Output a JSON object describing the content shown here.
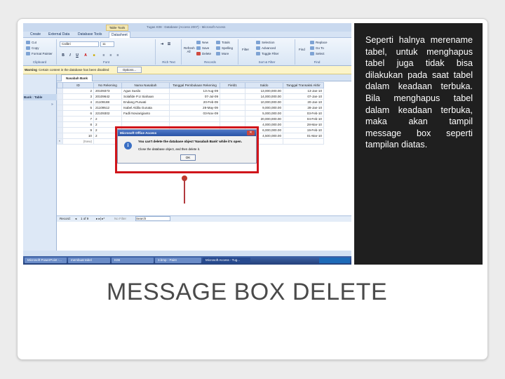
{
  "window": {
    "contextual_tab": "Table Tools",
    "title": "Tugas K08 : Database (Access 2007) - Microsoft Access"
  },
  "ribbon": {
    "tabs": [
      "Create",
      "External Data",
      "Database Tools",
      "Datasheet"
    ],
    "clipboard": {
      "cut": "Cut",
      "copy": "Copy",
      "painter": "Format Painter",
      "label": "Clipboard"
    },
    "font": {
      "name": "Calibri",
      "size": "11",
      "label": "Font"
    },
    "rich_text_label": "Rich Text",
    "records": {
      "new": "New",
      "save": "Save",
      "delete": "Delete",
      "refresh": "Refresh All",
      "spelling": "Spelling",
      "more": "More",
      "totals": "Totals",
      "label": "Records"
    },
    "sort": {
      "filter": "Filter",
      "selection": "Selection",
      "advanced": "Advanced",
      "toggle": "Toggle Filter",
      "label": "Sort & Filter"
    },
    "find": {
      "find": "Find",
      "replace": "Replace",
      "goto": "Go To",
      "select": "Select",
      "label": "Find"
    }
  },
  "security": {
    "label": "Warning",
    "message": "Certain content in the database has been disabled",
    "options": "Options..."
  },
  "nav": {
    "header": "Bank : Table"
  },
  "table": {
    "tab": "Nasabah Bank",
    "columns": [
      "ID",
      "No Rekening",
      "Nama Nasabah",
      "Tanggal Pembukaan Rekening",
      "Field1",
      "Saldo",
      "Tanggal Transaksi Akhir"
    ],
    "rows": [
      [
        "2",
        "20109373",
        "Agus Susilo",
        "13-Aug-09",
        "",
        "13,000,000.00",
        "13-Jan-10"
      ],
      [
        "3",
        "20109642",
        "Solafide P.U Siahaan",
        "07-Jul-09",
        "",
        "14,000,000.00",
        "07-Jan-10"
      ],
      [
        "4",
        "21109188",
        "Endang Purwati",
        "20-Feb-09",
        "",
        "10,000,000.00",
        "20-Jan-10"
      ],
      [
        "5",
        "21109512",
        "Isabel Aldila Gunata",
        "28-May-09",
        "",
        "9,000,000.00",
        "28-Jan-10"
      ],
      [
        "6",
        "22109302",
        "Fadli Noviarigianto",
        "03-Nov-09",
        "",
        "5,000,000.00",
        "03-Feb-10"
      ],
      [
        "7",
        "2",
        "",
        "",
        "",
        "20,000,000.00",
        "04-Feb-10"
      ],
      [
        "8",
        "2",
        "",
        "",
        "",
        "4,000,000.00",
        "28-Mar-10"
      ],
      [
        "9",
        "2",
        "",
        "",
        "",
        "6,000,000.00",
        "19-Feb-10"
      ],
      [
        "10",
        "2",
        "",
        "",
        "",
        "4,500,000.00",
        "01-Mar-10"
      ]
    ],
    "new_row": "(New)"
  },
  "record_nav": {
    "label": "Record:",
    "position": "1 of 9",
    "filter": "No Filter",
    "search": "Search"
  },
  "taskbar": {
    "items": [
      "Microsoft PowerPoint -...",
      "membuat tabel",
      "K08",
      "3.bmp - Paint",
      "Microsoft Access - Tug..."
    ]
  },
  "dialog": {
    "title": "Microsoft Office Access",
    "message": "You can't delete the database object 'Nasabah Bank' while it's open.",
    "sub": "Close the database object, and then delete it.",
    "ok": "OK"
  },
  "side_text": "Seperti halnya merename tabel, untuk menghapus tabel juga tidak bisa dilakukan pada saat tabel dalam keadaan terbuka. Bila menghapus tabel dalam keadaan terbuka, maka akan tampil message box seperti tampilan diatas.",
  "caption": "MESSAGE BOX DELETE",
  "colors": {
    "highlight_box": "#d0151b",
    "dark_panel": "#1f1f1f"
  }
}
